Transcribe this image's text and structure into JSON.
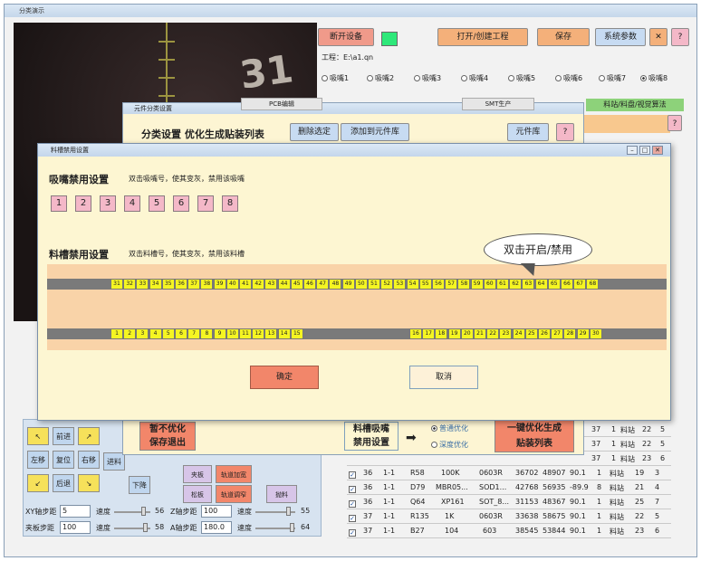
{
  "main": {
    "title": "分类演示",
    "buttons": {
      "disconnect": "断开设备",
      "open_project": "打开/创建工程",
      "save": "保存",
      "system_params": "系统参数",
      "close": "✕",
      "help": "?"
    },
    "project_path": "工程：E:\\a1.qn",
    "nozzles": [
      "吸嘴1",
      "吸嘴2",
      "吸嘴3",
      "吸嘴4",
      "吸嘴5",
      "吸嘴6",
      "吸嘴7",
      "吸嘴8"
    ],
    "selected_nozzle_index": 7,
    "right_tab": "料站/料盘/视觉算法",
    "camera_digit": "31"
  },
  "jog": {
    "buttons": [
      "↖",
      "前进",
      "↗",
      "左移",
      "复位",
      "右移",
      "↙",
      "后退",
      "↘"
    ],
    "extra": [
      "进料",
      "下降"
    ],
    "xy_step_label": "XY轴步距",
    "xy_step": "5",
    "speed_label": "速度",
    "xy_speed": "56",
    "z_step_label": "Z轴步距",
    "z_step": "100",
    "z_speed": "55",
    "clamp_step_label": "夹板步距",
    "clamp_step": "100",
    "clamp_speed": "58",
    "a_step_label": "A轴步距",
    "a_step": "180.0",
    "a_speed": "64",
    "tool_buttons": [
      "夹板",
      "轨道加宽",
      "松板",
      "轨道调窄",
      "抛料"
    ]
  },
  "class_dialog": {
    "title": "元件分类设置",
    "heading": "分类设置 优化生成贴装列表",
    "delete_selected": "删除选定",
    "add_to_library": "添加到元件库",
    "component_library": "元件库",
    "help": "?",
    "tabs": [
      "PCB编辑",
      "SMT生产"
    ],
    "no_opt_save_exit": "暂不优化\n保存退出",
    "feeder_nozzle_disable": "料槽吸嘴\n禁用设置",
    "opt_normal": "普通优化",
    "opt_deep": "深度优化",
    "one_click": "一键优化生成\n贴装列表"
  },
  "disable_dialog": {
    "title": "料槽禁用设置",
    "nozzle_heading": "吸嘴禁用设置",
    "nozzle_hint": "双击吸嘴号，使其变灰，禁用该吸嘴",
    "nozzle_numbers": [
      "1",
      "2",
      "3",
      "4",
      "5",
      "6",
      "7",
      "8"
    ],
    "feeder_heading": "料槽禁用设置",
    "feeder_hint": "双击料槽号，使其变灰，禁用该料槽",
    "callout": "双击开启/禁用",
    "top_row": [
      "31",
      "32",
      "33",
      "34",
      "35",
      "36",
      "37",
      "38",
      "39",
      "40",
      "41",
      "42",
      "43",
      "44",
      "45",
      "46",
      "47",
      "48",
      "49",
      "50",
      "51",
      "52",
      "53",
      "54",
      "55",
      "56",
      "57",
      "58",
      "59",
      "60",
      "61",
      "62",
      "63",
      "64",
      "65",
      "66",
      "67",
      "68"
    ],
    "bottom_row_a": [
      "1",
      "2",
      "3",
      "4",
      "5",
      "6",
      "7",
      "8",
      "9",
      "10",
      "11",
      "12",
      "13",
      "14",
      "15"
    ],
    "bottom_row_b": [
      "16",
      "17",
      "18",
      "19",
      "20",
      "21",
      "22",
      "23",
      "24",
      "25",
      "26",
      "27",
      "28",
      "29",
      "30"
    ],
    "confirm": "确定",
    "cancel": "取消"
  },
  "table": {
    "side_rows": [
      [
        "37",
        "1",
        "料站",
        "22",
        "5"
      ],
      [
        "37",
        "1",
        "料站",
        "22",
        "5"
      ],
      [
        "37",
        "1",
        "料站",
        "23",
        "6"
      ]
    ],
    "rows": [
      [
        "36",
        "1-1",
        "R58",
        "100K",
        "0603R",
        "36702",
        "48907",
        "90.1",
        "1",
        "料站",
        "19",
        "3"
      ],
      [
        "36",
        "1-1",
        "D79",
        "MBR05...",
        "SOD1...",
        "42768",
        "56935",
        "-89.9",
        "8",
        "料站",
        "21",
        "4"
      ],
      [
        "36",
        "1-1",
        "Q64",
        "XP161",
        "SOT_8...",
        "31153",
        "48367",
        "90.1",
        "1",
        "料站",
        "25",
        "7"
      ],
      [
        "37",
        "1-1",
        "R135",
        "1K",
        "0603R",
        "33638",
        "58675",
        "90.1",
        "1",
        "料站",
        "22",
        "5"
      ],
      [
        "37",
        "1-1",
        "B27",
        "104",
        "603",
        "38545",
        "53844",
        "90.1",
        "1",
        "料站",
        "23",
        "6"
      ]
    ]
  }
}
